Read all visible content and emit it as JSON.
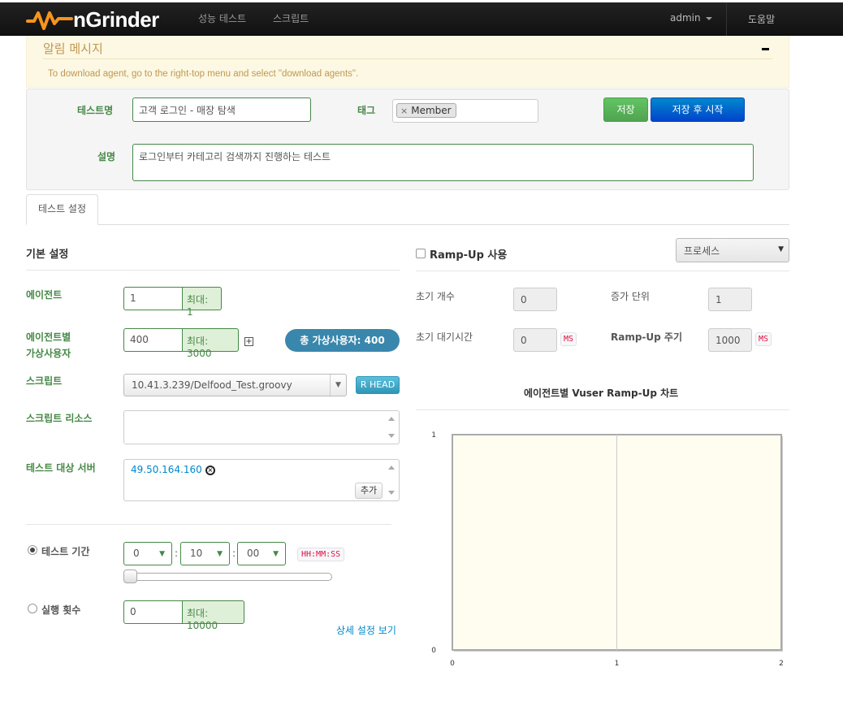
{
  "nav": {
    "brand": "nGrinder",
    "links": [
      "성능 테스트",
      "스크립트"
    ],
    "user": "admin",
    "help": "도움말"
  },
  "alert": {
    "title": "알림 메시지",
    "message": "To download agent, go to the right-top menu and select \"download agents\"."
  },
  "test": {
    "name_label": "테스트명",
    "name_value": "고객 로그인 - 매장 탐색",
    "tag_label": "태그",
    "tag_remove": "×",
    "tags": [
      "Member"
    ],
    "desc_label": "설명",
    "desc_value": "로그인부터 카테고리 검색까지 진행하는 테스트",
    "save_label": "저장",
    "save_start_label": "저장 후 시작"
  },
  "tabs": [
    "테스트 설정"
  ],
  "basic": {
    "title": "기본 설정",
    "agent_label": "에이전트",
    "agent_value": "1",
    "agent_max": "최대: 1",
    "vuser_label_1": "에이전트별",
    "vuser_label_2": "가상사용자",
    "vuser_value": "400",
    "vuser_max": "최대: 3000",
    "plus": "+",
    "total_vuser": "총 가상사용자: 400",
    "script_label": "스크립트",
    "script_value": "10.41.3.239/Delfood_Test.groovy",
    "script_head": "R HEAD",
    "resource_label": "스크립트 리소스",
    "target_label": "테스트 대상 서버",
    "target_host": "49.50.164.160",
    "target_remove": "×",
    "add_label": "추가",
    "duration_label": "테스트 기간",
    "duration_hh": "0",
    "duration_mm": "10",
    "duration_ss": "00",
    "duration_sep": ":",
    "duration_format": "HH:MM:SS",
    "duration_slider": 0,
    "runcount_label": "실행 횟수",
    "runcount_value": "0",
    "runcount_max": "최대: 10000",
    "advanced_link": "상세 설정 보기"
  },
  "rampup": {
    "enable_label": "Ramp-Up 사용",
    "enabled": false,
    "type_value": "프로세스",
    "init_count_label": "초기 개수",
    "init_count_value": "0",
    "step_label": "증가 단위",
    "step_value": "1",
    "init_sleep_label": "초기 대기시간",
    "init_sleep_value": "0",
    "interval_label": "Ramp-Up 주기",
    "interval_value": "1000",
    "unit_ms": "MS"
  },
  "chart_data": {
    "type": "line",
    "title": "에이전트별 Vuser Ramp-Up 차트",
    "x": [
      0,
      1,
      2
    ],
    "xlim": [
      0,
      2
    ],
    "ylim": [
      0,
      1
    ],
    "x_ticks": [
      "0",
      "1",
      "2"
    ],
    "y_ticks": [
      "0",
      "1"
    ],
    "series": [],
    "background": "#fffdf0"
  },
  "colors": {
    "success": "#468847",
    "primary": "#0044cc",
    "info": "#3a87ad",
    "warning_text": "#c09853"
  }
}
